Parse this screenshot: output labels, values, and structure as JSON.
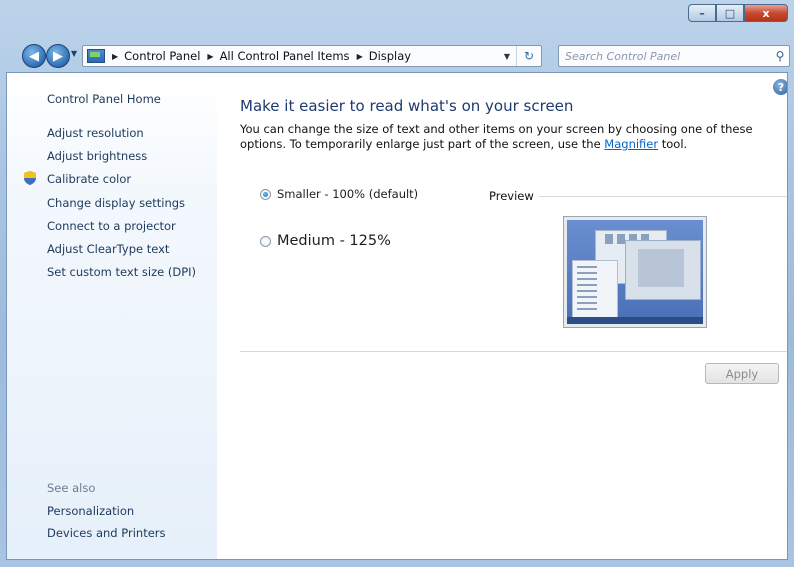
{
  "window": {
    "caption_buttons": {
      "minimize": "–",
      "maximize": "□",
      "close": "x"
    }
  },
  "navigation": {
    "breadcrumbs": [
      "Control Panel",
      "All Control Panel Items",
      "Display"
    ],
    "search_placeholder": "Search Control Panel"
  },
  "sidebar": {
    "home": "Control Panel Home",
    "items": [
      "Adjust resolution",
      "Adjust brightness",
      "Calibrate color",
      "Change display settings",
      "Connect to a projector",
      "Adjust ClearType text",
      "Set custom text size (DPI)"
    ],
    "see_also_label": "See also",
    "see_also": [
      "Personalization",
      "Devices and Printers"
    ]
  },
  "main": {
    "title": "Make it easier to read what's on your screen",
    "description_part1": "You can change the size of text and other items on your screen by choosing one of these options. To temporarily enlarge just part of the screen, use the",
    "magnifier_link": "Magnifier",
    "description_part2": "tool.",
    "options": [
      {
        "label": "Smaller - 100% (default)",
        "selected": true
      },
      {
        "label": "Medium - 125%",
        "selected": false
      }
    ],
    "preview_label": "Preview",
    "apply": "Apply"
  },
  "colors": {
    "title_text": "#1e3a6e",
    "link": "#0066cc",
    "sidebar_link": "#1e395b",
    "preview_desktop": "#5a7fc4"
  }
}
